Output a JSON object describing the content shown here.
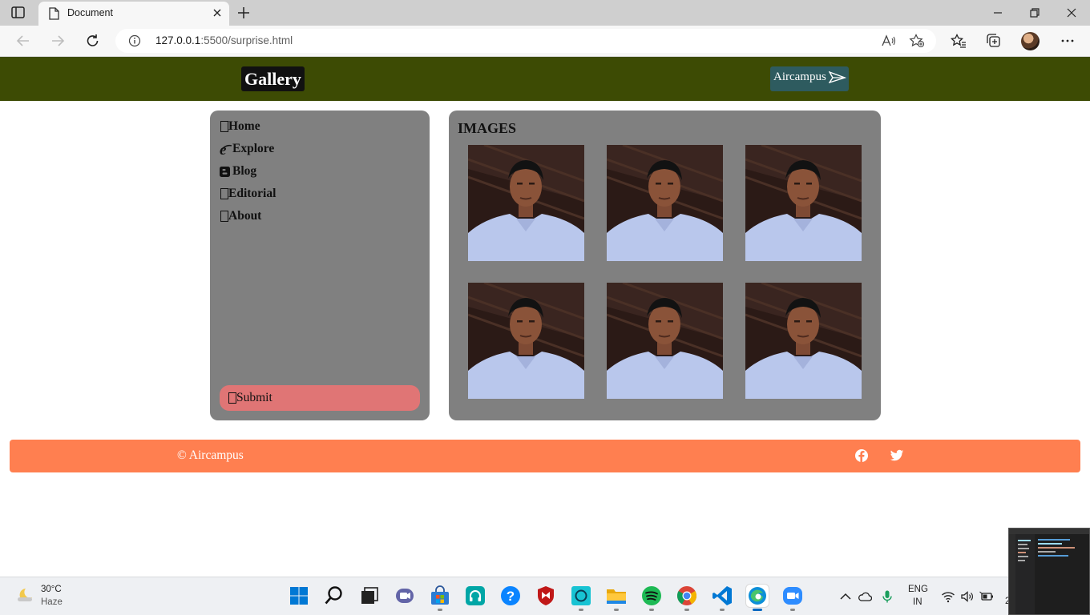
{
  "browser": {
    "tab_title": "Document",
    "url_host": "127.0.0.1",
    "url_rest": ":5500/surprise.html"
  },
  "header": {
    "title": "Gallery",
    "brand": "Aircampus"
  },
  "sidebar": {
    "items": [
      {
        "label": "Home"
      },
      {
        "label": "Explore"
      },
      {
        "label": "Blog"
      },
      {
        "label": "Editorial"
      },
      {
        "label": "About"
      }
    ],
    "submit_label": "Submit"
  },
  "gallery": {
    "title": "IMAGES",
    "image_count": 6
  },
  "footer": {
    "copyright": "© Aircampus",
    "social_icons": [
      "facebook-icon",
      "twitter-icon"
    ]
  },
  "taskbar": {
    "weather_temp": "30°C",
    "weather_condition": "Haze",
    "lang_line1": "ENG",
    "lang_line2": "IN",
    "clock_fragment": "2"
  },
  "colors": {
    "header_bg": "#3d4b04",
    "panel_bg": "#808080",
    "submit_bg": "#e07575",
    "footer_bg": "#ff7f50",
    "brand_badge_bg": "#2e5b5f"
  }
}
